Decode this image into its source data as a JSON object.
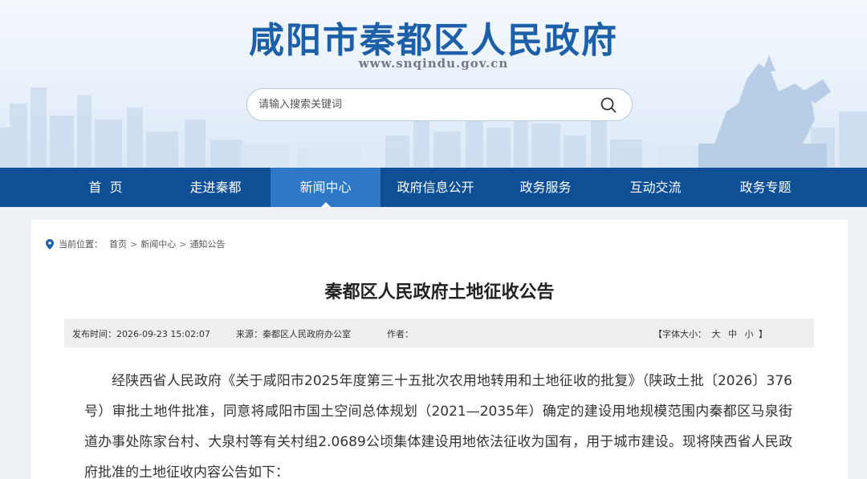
{
  "header": {
    "site_title": "咸阳市秦都区人民政府",
    "site_domain": "www.snqindu.gov.cn",
    "search_placeholder": "请输入搜索关键词"
  },
  "nav": {
    "items": [
      {
        "label": "首  页"
      },
      {
        "label": "走进秦都"
      },
      {
        "label": "新闻中心",
        "active": true
      },
      {
        "label": "政府信息公开"
      },
      {
        "label": "政务服务"
      },
      {
        "label": "互动交流"
      },
      {
        "label": "政务专题"
      }
    ]
  },
  "breadcrumb": {
    "prefix": "当前位置：",
    "items": [
      "首页",
      "新闻中心",
      "通知公告"
    ],
    "separator": ">"
  },
  "article": {
    "title": "秦都区人民政府土地征收公告",
    "meta": {
      "publish_time": "发布时间：2026-09-23 15:02:07",
      "source": "来源：秦都区人民政府办公室",
      "author": "作者：",
      "font_size_label_open": "【字体大小：",
      "font_size_large": "大",
      "font_size_medium": "中",
      "font_size_small": "小",
      "font_size_label_close": "】"
    },
    "body": "经陕西省人民政府《关于咸阳市2025年度第三十五批次农用地转用和土地征收的批复》（陕政土批〔2026〕376号）审批土地件批准，同意将咸阳市国土空间总体规划（2021—2035年）确定的建设用地规模范围内秦都区马泉街道办事处陈家台村、大泉村等有关村组2.0689公顷集体建设用地依法征收为国有，用于城市建设。现将陕西省人民政府批准的土地征收内容公告如下："
  },
  "colors": {
    "nav_bg": "#0f4f95",
    "nav_active": "#2f78c7",
    "title_blue": "#1d5fa8"
  }
}
